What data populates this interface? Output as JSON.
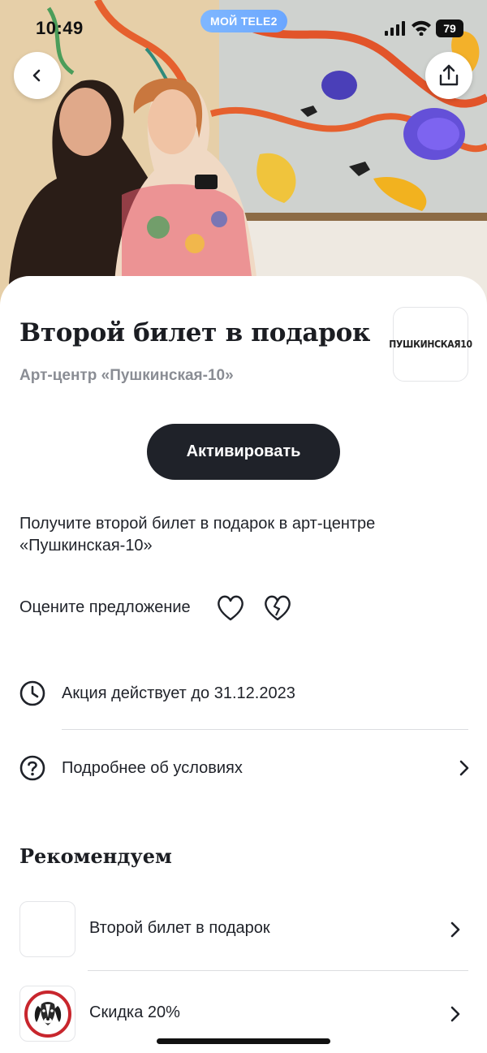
{
  "status_bar": {
    "time": "10:49",
    "carrier": "МОЙ TELE2",
    "battery": "79"
  },
  "header": {
    "back_icon": "chevron-left-icon",
    "share_icon": "share-icon"
  },
  "offer": {
    "title": "Второй билет в подарок",
    "partner": "Арт-центр «Пушкинская-10»",
    "logo_text": "ПУШКИНСКАЯ10",
    "activate_label": "Активировать",
    "description": "Получите второй билет в подарок в арт-центре «Пушкинская-10»"
  },
  "rating": {
    "label": "Оцените предложение",
    "like_icon": "heart-icon",
    "dislike_icon": "broken-heart-icon"
  },
  "details": {
    "valid_until": "Акция действует до 31.12.2023",
    "terms_label": "Подробнее об условиях"
  },
  "recommendations": {
    "title": "Рекомендуем",
    "items": [
      {
        "label": "Второй билет в подарок"
      },
      {
        "label": "Скидка 20%"
      }
    ]
  },
  "colors": {
    "primary_button": "#1f2229",
    "carrier_pill": "#6aa6ff",
    "secondary_text": "#8a8d94"
  }
}
